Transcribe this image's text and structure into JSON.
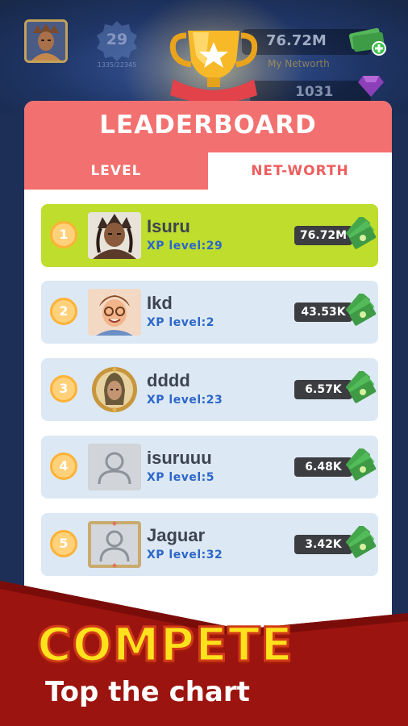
{
  "hud": {
    "level": "29",
    "xp_progress": "1335/22345",
    "networth_value": "76.72M",
    "networth_label": "My Networth",
    "gems_value": "1031"
  },
  "leaderboard": {
    "title": "LEADERBOARD",
    "tabs": [
      {
        "label": "LEVEL",
        "active": false
      },
      {
        "label": "NET-WORTH",
        "active": true
      }
    ],
    "rows": [
      {
        "rank": "1",
        "name": "Isuru",
        "xp": "XP level:29",
        "worth": "76.72M",
        "highlight": true,
        "avatar": "warrior-avatar"
      },
      {
        "rank": "2",
        "name": "Ikd",
        "xp": "XP level:2",
        "worth": "43.53K",
        "highlight": false,
        "avatar": "cartoon-man-avatar"
      },
      {
        "rank": "3",
        "name": "dddd",
        "xp": "XP level:23",
        "worth": "6.57K",
        "highlight": false,
        "avatar": "gold-frame-warrior-avatar"
      },
      {
        "rank": "4",
        "name": "isuruuu",
        "xp": "XP level:5",
        "worth": "6.48K",
        "highlight": false,
        "avatar": "default-user-avatar"
      },
      {
        "rank": "5",
        "name": "Jaguar",
        "xp": "XP level:32",
        "worth": "3.42K",
        "highlight": false,
        "avatar": "framed-default-user-avatar"
      }
    ]
  },
  "promo": {
    "headline": "COMPETE",
    "tagline": "Top the chart"
  },
  "colors": {
    "header": "#f2706f",
    "highlight_row": "#bedd2c",
    "row": "#dce8f4",
    "xp_text": "#2d67c9",
    "rank_badge": "#ffd17a",
    "banner": "#9c1410",
    "headline": "#ffe21c"
  }
}
